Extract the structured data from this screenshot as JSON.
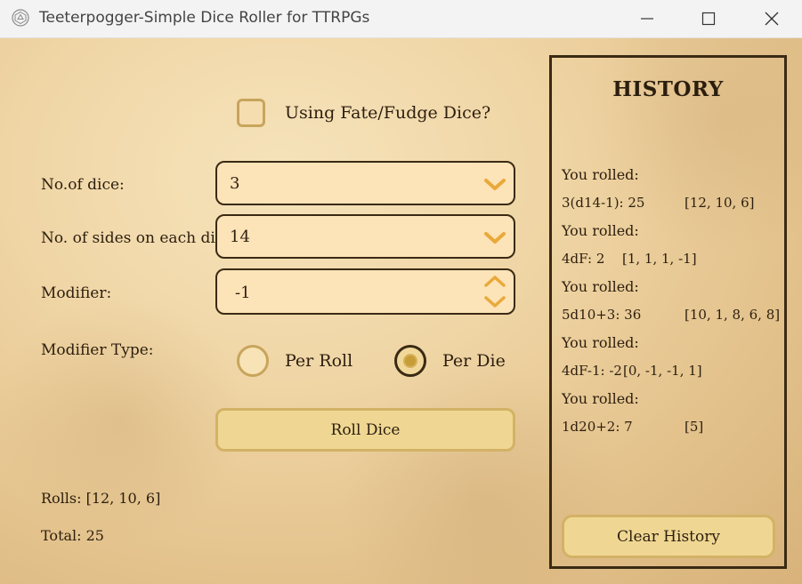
{
  "window": {
    "title": "Teeterpogger-Simple Dice Roller for TTRPGs"
  },
  "options": {
    "fate_dice_label": "Using Fate/Fudge Dice?",
    "fate_dice_checked": false
  },
  "fields": {
    "num_dice_label": "No.of dice:",
    "num_dice_value": "3",
    "sides_label": "No. of sides on each dice:",
    "sides_value": "14",
    "modifier_label": "Modifier:",
    "modifier_value": "-1",
    "modifier_type_label": "Modifier Type:",
    "per_roll_label": "Per Roll",
    "per_die_label": "Per Die",
    "modifier_type_selected": "Per Die"
  },
  "actions": {
    "roll_label": "Roll Dice",
    "clear_label": "Clear History"
  },
  "results": {
    "rolls_text": "Rolls: [12, 10, 6]",
    "total_text": "Total: 25"
  },
  "history": {
    "title": "HISTORY",
    "entries": [
      {
        "header": "You rolled:",
        "dice": "3(d14-1): 25",
        "rolls": "[12, 10, 6]"
      },
      {
        "header": "You rolled:",
        "dice": "4dF: 2",
        "rolls": "[1, 1, 1, -1]"
      },
      {
        "header": "You rolled:",
        "dice": "5d10+3: 36",
        "rolls": "[10, 1, 8, 6, 8]"
      },
      {
        "header": "You rolled:",
        "dice": "4dF-1: -2",
        "rolls": "[0, -1, -1, 1]"
      },
      {
        "header": "You rolled:",
        "dice": "1d20+2: 7",
        "rolls": "[5]"
      }
    ]
  },
  "icons": {
    "app": "d20-icon",
    "minimize": "minimize-icon",
    "maximize": "maximize-icon",
    "close": "close-icon",
    "dropdown": "chevron-down-icon",
    "spin_up": "chevron-up-icon"
  },
  "colors": {
    "accent": "#c8a55c",
    "button_fill": "#efd793",
    "field_fill": "#fde3b8",
    "chevron": "#e9a93a",
    "ink": "#2c1e0e"
  }
}
